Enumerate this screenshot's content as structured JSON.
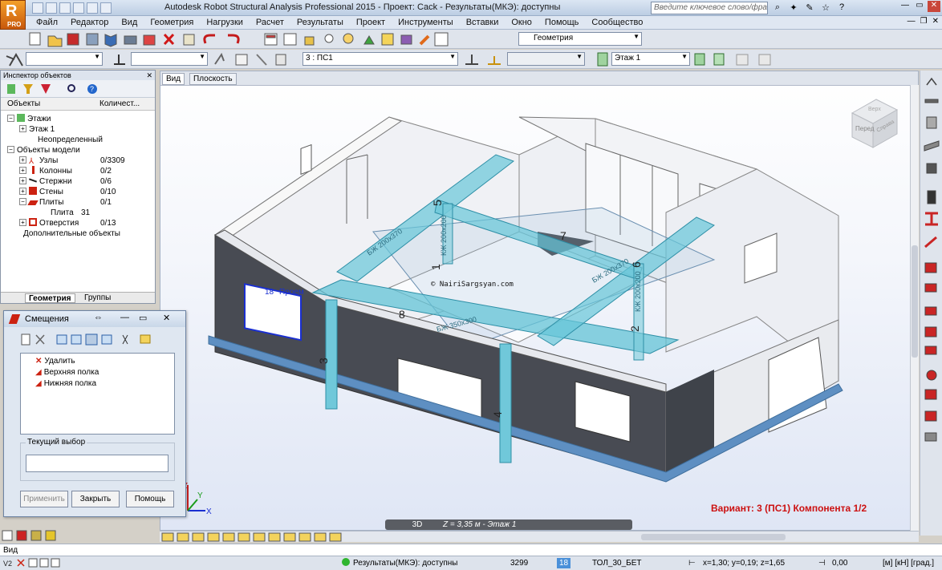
{
  "app": {
    "title": "Autodesk Robot Structural Analysis Professional 2015 - Проект: Cack - Результаты(МКЭ): доступны",
    "logo_letter": "R",
    "logo_sub": "PRO",
    "search_placeholder": "Введите ключевое слово/фразу"
  },
  "menu": [
    "Файл",
    "Редактор",
    "Вид",
    "Геометрия",
    "Нагрузки",
    "Расчет",
    "Результаты",
    "Проект",
    "Инструменты",
    "Вставки",
    "Окно",
    "Помощь",
    "Сообщество"
  ],
  "toolbar": {
    "geometry_combo": "Геометрия",
    "case_combo": "3 : ПС1",
    "floor_combo": "Этаж 1"
  },
  "inspector": {
    "title": "Инспектор объектов",
    "col_objects": "Объекты",
    "col_count": "Количест...",
    "tree": [
      {
        "label": "Этажи",
        "count": ""
      },
      {
        "label": "Этаж 1",
        "count": ""
      },
      {
        "label": "Неопределенный",
        "count": ""
      },
      {
        "label": "Объекты модели",
        "count": ""
      },
      {
        "label": "Узлы",
        "count": "0/3309"
      },
      {
        "label": "Колонны",
        "count": "0/2"
      },
      {
        "label": "Стержни",
        "count": "0/6"
      },
      {
        "label": "Стены",
        "count": "0/10"
      },
      {
        "label": "Плиты",
        "count": "0/1"
      },
      {
        "label": "Плита",
        "count": "31"
      },
      {
        "label": "Отверстия",
        "count": "0/13"
      },
      {
        "label": "Дополнительные объекты",
        "count": ""
      }
    ],
    "tabs": [
      "Геометрия",
      "Группы"
    ]
  },
  "dialog": {
    "title": "Смещения",
    "items": [
      "Удалить",
      "Верхняя полка",
      "Нижняя полка"
    ],
    "current_selection_label": "Текущий выбор",
    "apply": "Применить",
    "close": "Закрыть",
    "help": "Помощь"
  },
  "view": {
    "tabs": [
      "Вид",
      "Плоскость"
    ],
    "mode": "3D",
    "z_level": "Z = 3,35 м - Этаж 1",
    "variant": "Вариант: 3 (ПС1) Компонента 1/2",
    "watermark": "© NairiSargsyan.com",
    "labels": [
      "БЖ 200х370",
      "КЖ 200х200",
      "КЖ 200х200",
      "БЖ 200х370",
      "БЖ 350х300",
      "7",
      "8",
      "1",
      "2",
      "3",
      "4",
      "5",
      "6",
      "18",
      "Проем"
    ],
    "viewcube_front": "Перед",
    "viewcube_right": "Справа",
    "viewcube_top": "Верх",
    "axes": {
      "x": "X",
      "y": "Y",
      "z": "Z"
    }
  },
  "command_line": "Вид",
  "status": {
    "results": "Результаты(МКЭ): доступны",
    "nodes": "3299",
    "badge": "18",
    "section": "ТОЛ_30_БЕТ",
    "coords": "x=1,30; y=0,19; z=1,65",
    "angle": "0,00",
    "units": "[м] [кН] [град.]"
  },
  "colors": {
    "accent_red": "#cc1111",
    "beam_cyan": "#5fbfd6",
    "wall_dark": "#44474f",
    "wall_light": "#e9ebf0"
  }
}
